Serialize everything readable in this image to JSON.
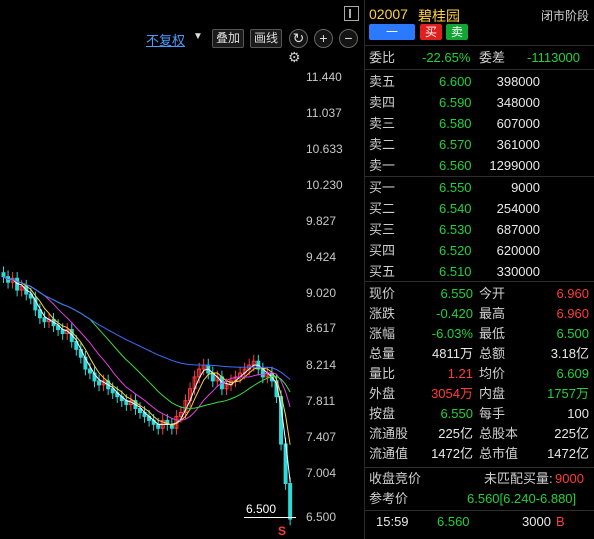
{
  "toolbar": {
    "adjust_label": "不复权",
    "overlay_label": "叠加",
    "draw_label": "画线",
    "refresh_icon": "refresh-icon",
    "zoom_in_symbol": "+",
    "zoom_out_symbol": "−"
  },
  "chart": {
    "price_labels": [
      "11.440",
      "11.037",
      "10.633",
      "10.230",
      "9.827",
      "9.424",
      "9.020",
      "8.617",
      "8.214",
      "7.811",
      "7.407",
      "7.004",
      "6.500"
    ],
    "last_price_tag": "6.500",
    "marker": "S"
  },
  "chart_data": {
    "type": "candlestick",
    "y_ticks": [
      11.44,
      11.037,
      10.633,
      10.23,
      9.827,
      9.424,
      9.02,
      8.617,
      8.214,
      7.811,
      7.407,
      7.004,
      6.5
    ],
    "last_price": 6.5,
    "colors": {
      "up": "#ff3b3b",
      "down": "#2fd9d9"
    },
    "moving_average_colors": [
      "#ffffff",
      "#ffd23d",
      "#e040e0",
      "#3ddc3d",
      "#3d6dff"
    ]
  },
  "quote": {
    "code": "02007",
    "name": "碧桂园",
    "status": "闭市阶段",
    "buttons": {
      "one": "一",
      "buy": "买",
      "sell": "卖"
    },
    "weibi_label": "委比",
    "weibi_value": "-22.65%",
    "weicha_label": "委差",
    "weicha_value": "-1113000",
    "asks": [
      {
        "label": "卖五",
        "price": "6.600",
        "vol": "398000"
      },
      {
        "label": "卖四",
        "price": "6.590",
        "vol": "348000"
      },
      {
        "label": "卖三",
        "price": "6.580",
        "vol": "607000"
      },
      {
        "label": "卖二",
        "price": "6.570",
        "vol": "361000"
      },
      {
        "label": "卖一",
        "price": "6.560",
        "vol": "1299000"
      }
    ],
    "bids": [
      {
        "label": "买一",
        "price": "6.550",
        "vol": "9000"
      },
      {
        "label": "买二",
        "price": "6.540",
        "vol": "254000"
      },
      {
        "label": "买三",
        "price": "6.530",
        "vol": "687000"
      },
      {
        "label": "买四",
        "price": "6.520",
        "vol": "620000"
      },
      {
        "label": "买五",
        "price": "6.510",
        "vol": "330000"
      }
    ],
    "stats": [
      {
        "l1": "现价",
        "v1": "6.550",
        "l2": "今开",
        "v2": "6.960"
      },
      {
        "l1": "涨跌",
        "v1": "-0.420",
        "l2": "最高",
        "v2": "6.960"
      },
      {
        "l1": "涨幅",
        "v1": "-6.03%",
        "l2": "最低",
        "v2": "6.500"
      },
      {
        "l1": "总量",
        "v1": "4811万",
        "l2": "总额",
        "v2": "3.18亿"
      },
      {
        "l1": "量比",
        "v1": "1.21",
        "l2": "均价",
        "v2": "6.609"
      },
      {
        "l1": "外盘",
        "v1": "3054万",
        "l2": "内盘",
        "v2": "1757万"
      },
      {
        "l1": "按盘",
        "v1": "6.550",
        "l2": "每手",
        "v2": "100"
      },
      {
        "l1": "流通股",
        "v1": "225亿",
        "l2": "总股本",
        "v2": "225亿"
      },
      {
        "l1": "流通值",
        "v1": "1472亿",
        "l2": "总市值",
        "v2": "1472亿"
      }
    ],
    "auction_label": "收盘竞价",
    "unmatched_label": "未匹配买量:",
    "unmatched_value": "9000",
    "ref_label": "参考价",
    "ref_value": "6.560[6.240-6.880]",
    "tick_time": "15:59",
    "tick_price": "6.560",
    "tick_vol": "3000",
    "tick_side": "B"
  }
}
